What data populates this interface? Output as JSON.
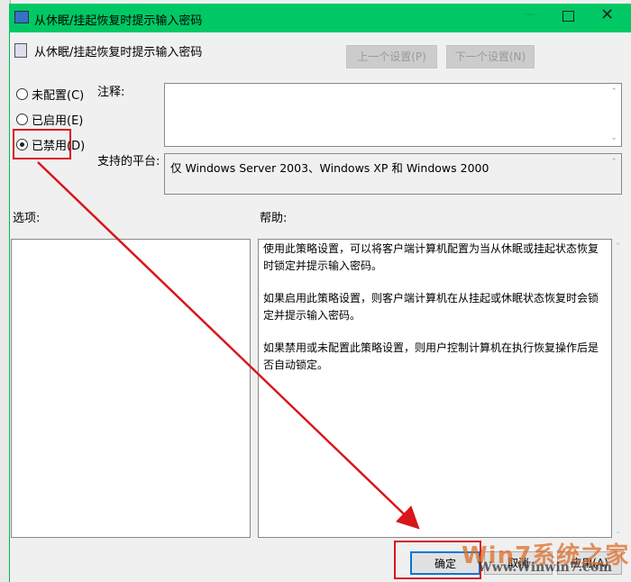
{
  "window": {
    "title": "从休眠/挂起恢复时提示输入密码",
    "header": "从休眠/挂起恢复时提示输入密码"
  },
  "nav": {
    "prev": "上一个设置(P)",
    "next": "下一个设置(N)"
  },
  "radios": [
    {
      "label": "未配置(C)",
      "checked": false
    },
    {
      "label": "已启用(E)",
      "checked": false
    },
    {
      "label": "已禁用(D)",
      "checked": true
    }
  ],
  "comment": {
    "label": "注释:",
    "value": ""
  },
  "platform": {
    "label": "支持的平台:",
    "value": "仅 Windows Server 2003、Windows XP 和 Windows 2000"
  },
  "options": {
    "label": "选项:"
  },
  "help": {
    "label": "帮助:",
    "paragraphs": [
      "使用此策略设置，可以将客户端计算机配置为当从休眠或挂起状态恢复时锁定并提示输入密码。",
      "如果启用此策略设置，则客户端计算机在从挂起或休眠状态恢复时会锁定并提示输入密码。",
      "如果禁用或未配置此策略设置，则用户控制计算机在执行恢复操作后是否自动锁定。"
    ]
  },
  "buttons": {
    "ok": "确定",
    "cancel": "取消",
    "apply": "应用(A)"
  },
  "watermark": {
    "brand": "Win7系统之家",
    "url": "Www.Winwin7.com"
  },
  "colors": {
    "titlebar": "#00c864",
    "annotation": "#d8161c"
  }
}
